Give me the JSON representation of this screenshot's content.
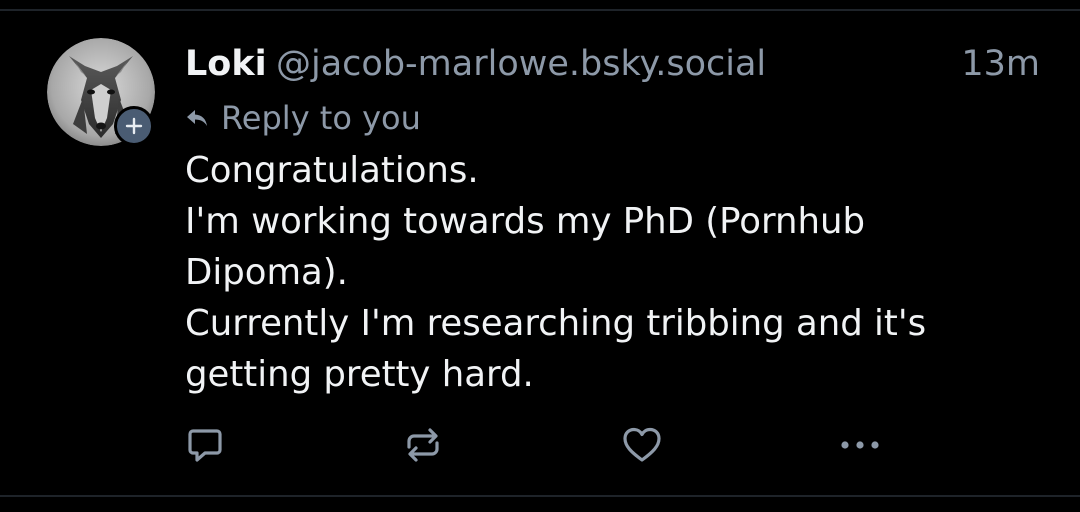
{
  "post": {
    "author_name": "Loki",
    "author_handle": "@jacob-marlowe.bsky.social",
    "timestamp": "13m",
    "reply_context": "Reply to you",
    "text_lines": [
      "Congratulations.",
      "I'm working towards my PhD (Pornhub",
      "Dipoma).",
      "Currently I'm researching tribbing and it's",
      "getting pretty hard."
    ]
  },
  "icons": {
    "avatar": "wolf-avatar",
    "follow": "plus-icon",
    "reply_context": "reply-arrow-icon",
    "reply_action": "comment-icon",
    "repost_action": "repost-icon",
    "like_action": "heart-icon",
    "more_action": "ellipsis-icon"
  },
  "colors": {
    "background": "#000000",
    "text_primary": "#f1f3f5",
    "text_secondary": "#8d99a8",
    "divider": "#1e2329",
    "badge": "#4a5c73"
  }
}
